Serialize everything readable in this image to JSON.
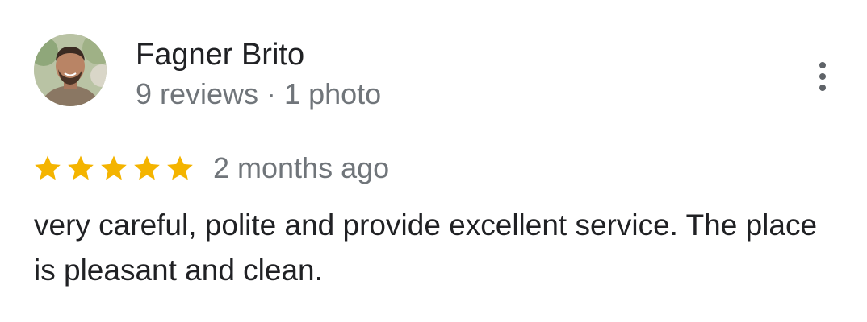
{
  "reviewer": {
    "name": "Fagner Brito",
    "meta": "9 reviews · 1 photo"
  },
  "rating": {
    "stars": 5,
    "max_stars": 5,
    "date": "2 months ago",
    "star_color": "#F4B400"
  },
  "review": {
    "text": "very careful, polite and provide excellent service. The place is pleasant and clean."
  },
  "icons": {
    "more": "more-vertical-icon",
    "star": "star-icon",
    "avatar": "reviewer-avatar"
  }
}
